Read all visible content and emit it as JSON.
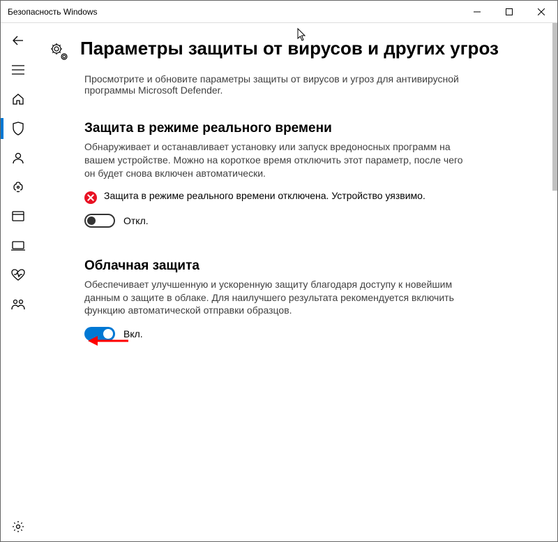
{
  "window": {
    "title": "Безопасность Windows"
  },
  "page": {
    "heading": "Параметры защиты от вирусов и других угроз",
    "subheading": "Просмотрите и обновите параметры защиты от вирусов и угроз для антивирусной программы Microsoft Defender."
  },
  "sections": {
    "realtime": {
      "title": "Защита в режиме реального времени",
      "desc": "Обнаруживает и останавливает установку или запуск вредоносных программ на вашем устройстве. Можно на короткое время отключить этот параметр, после чего он будет снова включен автоматически.",
      "alert": "Защита в режиме реального времени отключена. Устройство уязвимо.",
      "toggle_label": "Откл."
    },
    "cloud": {
      "title": "Облачная защита",
      "desc": "Обеспечивает улучшенную и ускоренную защиту благодаря доступу к новейшим данным о защите в облаке. Для наилучшего результата рекомендуется включить функцию автоматической отправки образцов.",
      "toggle_label": "Вкл."
    }
  }
}
